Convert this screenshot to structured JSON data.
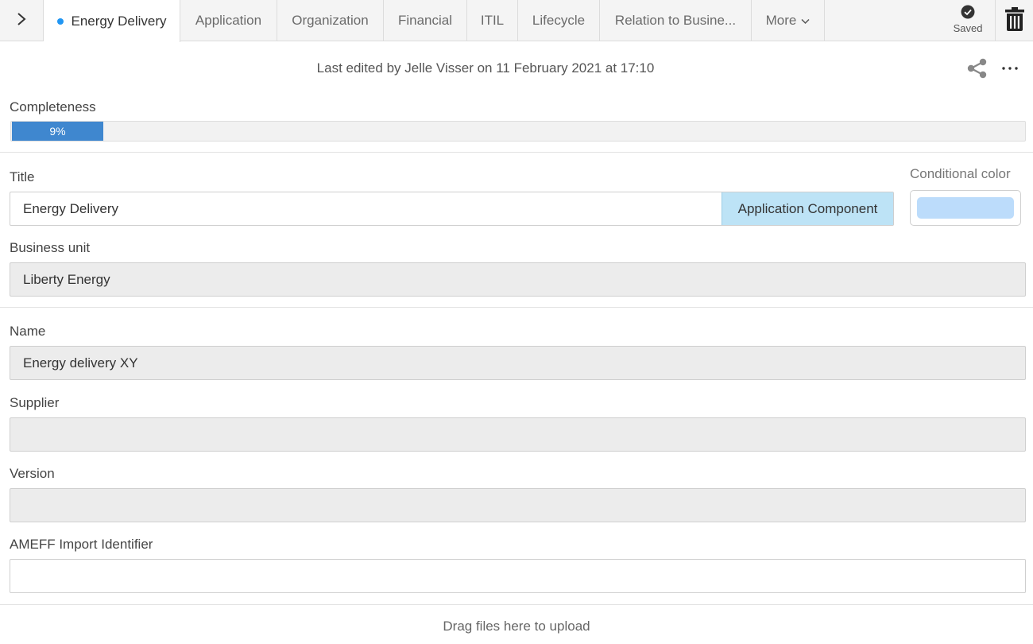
{
  "header": {
    "tabs": [
      {
        "label": "Energy Delivery",
        "active": true
      },
      {
        "label": "Application"
      },
      {
        "label": "Organization"
      },
      {
        "label": "Financial"
      },
      {
        "label": "ITIL"
      },
      {
        "label": "Lifecycle"
      },
      {
        "label": "Relation to Busine..."
      },
      {
        "label": "More"
      }
    ],
    "saved_label": "Saved",
    "icons": {
      "nav_toggle": "chevron-right-icon",
      "saved": "check-circle-icon",
      "delete": "trash-icon",
      "more_tab": "chevron-down-icon"
    }
  },
  "meta": {
    "last_edited": "Last edited by Jelle Visser on 11 February 2021 at 17:10",
    "icons": {
      "share": "share-icon",
      "menu": "more-horizontal-icon"
    }
  },
  "completeness": {
    "label": "Completeness",
    "value": 0.09,
    "text": "9%",
    "bar_color": "#3f87cf"
  },
  "form": {
    "title": {
      "label": "Title",
      "value": "Energy Delivery",
      "type_badge": "Application Component",
      "badge_color": "#bde3f6"
    },
    "conditional_color": {
      "label": "Conditional color",
      "swatch": "#bcdcfb"
    },
    "business_unit": {
      "label": "Business unit",
      "value": "Liberty Energy"
    },
    "name": {
      "label": "Name",
      "value": "Energy delivery XY"
    },
    "supplier": {
      "label": "Supplier",
      "value": ""
    },
    "version": {
      "label": "Version",
      "value": ""
    },
    "ameff": {
      "label": "AMEFF Import Identifier",
      "value": ""
    }
  },
  "dropzone": {
    "text": "Drag files here to upload"
  }
}
